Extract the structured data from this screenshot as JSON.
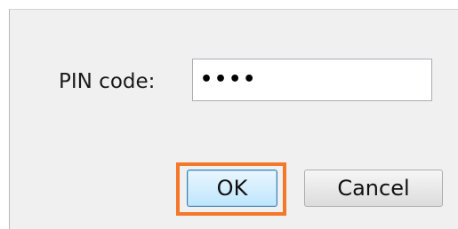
{
  "dialog": {
    "pin_label": "PIN code:",
    "pin_value": "••••",
    "ok_label": "OK",
    "cancel_label": "Cancel"
  },
  "colors": {
    "highlight": "#f4772a",
    "ok_border": "#3c7fb1",
    "dialog_bg": "#f0f0f0"
  }
}
